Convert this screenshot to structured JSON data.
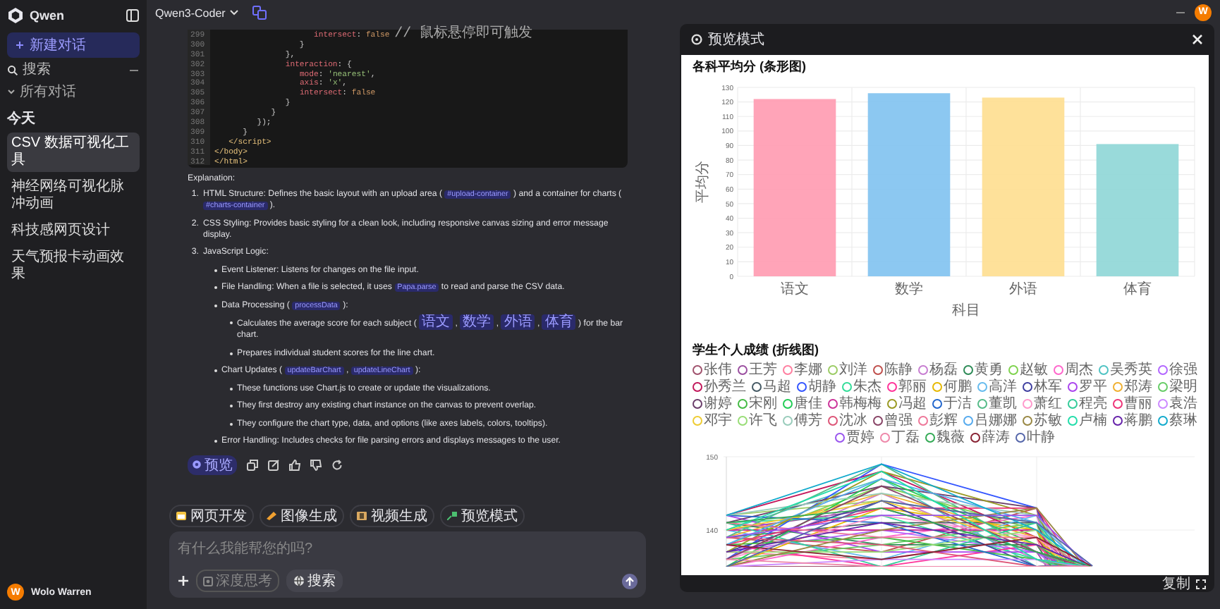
{
  "sidebar": {
    "brand": "Qwen",
    "new_chat": "新建对话",
    "search": {
      "placeholder": "搜索"
    },
    "section": {
      "label": "所有对话",
      "expanded": true
    },
    "group": "今天",
    "items": [
      {
        "label": "CSV 数据可视化工具",
        "selected": true
      },
      {
        "label": "神经网络可视化脉冲动画",
        "selected": false
      },
      {
        "label": "科技感网页设计",
        "selected": false
      },
      {
        "label": "天气预报卡动画效果",
        "selected": false
      }
    ],
    "user": {
      "initial": "W",
      "name": "Wolo Warren"
    }
  },
  "header": {
    "model": "Qwen3-Coder",
    "avatar": "W"
  },
  "code": {
    "lines": [
      {
        "n": "299",
        "text": "                     intersect: false // 鼠标悬停即可触发"
      },
      {
        "n": "300",
        "text": "                  }"
      },
      {
        "n": "301",
        "text": "               },"
      },
      {
        "n": "302",
        "text": "               interaction: {"
      },
      {
        "n": "303",
        "text": "                  mode: 'nearest',"
      },
      {
        "n": "304",
        "text": "                  axis: 'x',"
      },
      {
        "n": "305",
        "text": "                  intersect: false"
      },
      {
        "n": "306",
        "text": "               }"
      },
      {
        "n": "307",
        "text": "            }"
      },
      {
        "n": "308",
        "text": "         });"
      },
      {
        "n": "309",
        "text": "      }"
      },
      {
        "n": "310",
        "text": "   </script>"
      },
      {
        "n": "311",
        "text": "</body>"
      },
      {
        "n": "312",
        "text": "</html>"
      }
    ]
  },
  "explanation": {
    "heading": "Explanation:",
    "items": [
      {
        "marker": "1.",
        "parts": [
          {
            "text": "HTML Structure: Defines the basic layout with an upload area ( "
          },
          {
            "code": "#upload-container"
          },
          {
            "text": " ) and a container for charts ( "
          },
          {
            "code": "#charts-container"
          },
          {
            "text": " )."
          }
        ]
      },
      {
        "marker": "2.",
        "parts": [
          {
            "text": "CSS Styling: Provides basic styling for a clean look, including responsive canvas sizing and error message display."
          }
        ]
      },
      {
        "marker": "3.",
        "parts": [
          {
            "text": "JavaScript Logic:"
          }
        ],
        "children": [
          {
            "parts": [
              {
                "text": "Event Listener: Listens for changes on the file input."
              }
            ]
          },
          {
            "parts": [
              {
                "text": "File Handling: When a file is selected, it uses "
              },
              {
                "code": "Papa.parse"
              },
              {
                "text": " to read and parse the CSV data."
              }
            ]
          },
          {
            "parts": [
              {
                "text": "Data Processing ( "
              },
              {
                "code": "processData"
              },
              {
                "text": " ):"
              }
            ],
            "children": [
              {
                "parts": [
                  {
                    "text": "Calculates the average score for each subject ( "
                  },
                  {
                    "code": "语文"
                  },
                  {
                    "text": " , "
                  },
                  {
                    "code": "数学"
                  },
                  {
                    "text": " , "
                  },
                  {
                    "code": "外语"
                  },
                  {
                    "text": " , "
                  },
                  {
                    "code": "体育"
                  },
                  {
                    "text": " ) for the bar chart."
                  }
                ]
              },
              {
                "parts": [
                  {
                    "text": "Prepares individual student scores for the line chart."
                  }
                ]
              }
            ]
          },
          {
            "parts": [
              {
                "text": "Chart Updates ( "
              },
              {
                "code": "updateBarChart"
              },
              {
                "text": " , "
              },
              {
                "code": "updateLineChart"
              },
              {
                "text": " ):"
              }
            ],
            "children": [
              {
                "parts": [
                  {
                    "text": "These functions use Chart.js to create or update the visualizations."
                  }
                ]
              },
              {
                "parts": [
                  {
                    "text": "They first destroy any existing chart instance on the canvas to prevent overlap."
                  }
                ]
              },
              {
                "parts": [
                  {
                    "text": "They configure the chart type, data, and options (like axes labels, colors, tooltips)."
                  }
                ]
              }
            ]
          },
          {
            "parts": [
              {
                "text": "Error Handling: Includes checks for file parsing errors and displays messages to the user."
              }
            ]
          }
        ]
      }
    ]
  },
  "actions": {
    "preview": "预览"
  },
  "chips": [
    {
      "label": "网页开发",
      "kind": "web"
    },
    {
      "label": "图像生成",
      "kind": "image"
    },
    {
      "label": "视频生成",
      "kind": "video"
    },
    {
      "label": "预览模式",
      "kind": "preview"
    }
  ],
  "composer": {
    "placeholder": "有什么我能帮您的吗?",
    "deep_think": {
      "label": "深度思考",
      "on": false
    },
    "search": "搜索"
  },
  "preview": {
    "title": "预览模式",
    "copy": "复制",
    "bar_chart": {
      "title": "各科平均分 (条形图)",
      "chart_data": {
        "type": "bar",
        "xlabel": "科目",
        "ylabel": "平均分",
        "categories": [
          "语文",
          "数学",
          "外语",
          "体育"
        ],
        "values": [
          122,
          126,
          123,
          91
        ],
        "colors": [
          "#ff9fb4",
          "#86c5f0",
          "#fedf95",
          "#93d8d8"
        ],
        "grid": true,
        "ylim": [
          0,
          130
        ],
        "yticks": [
          0,
          10,
          20,
          30,
          40,
          50,
          60,
          70,
          80,
          90,
          100,
          110,
          120,
          130
        ]
      }
    },
    "line_chart": {
      "title": "学生个人成绩 (折线图)",
      "yticks": [
        "150",
        "140"
      ],
      "legend": [
        {
          "name": "张伟",
          "color": "#a0526d"
        },
        {
          "name": "王芳",
          "color": "#9b4fa0"
        },
        {
          "name": "李娜",
          "color": "#ff7fa0"
        },
        {
          "name": "刘洋",
          "color": "#9ccc65"
        },
        {
          "name": "陈静",
          "color": "#c0504d"
        },
        {
          "name": "杨磊",
          "color": "#c77dd1"
        },
        {
          "name": "黄勇",
          "color": "#2e8b57"
        },
        {
          "name": "赵敏",
          "color": "#7fd34e"
        },
        {
          "name": "周杰",
          "color": "#ff66cc"
        },
        {
          "name": "吴秀英",
          "color": "#4fc3c3"
        },
        {
          "name": "徐强",
          "color": "#b266ff"
        },
        {
          "name": "孙秀兰",
          "color": "#c2185b"
        },
        {
          "name": "马超",
          "color": "#455a64"
        },
        {
          "name": "胡静",
          "color": "#3355ff"
        },
        {
          "name": "朱杰",
          "color": "#33dd99"
        },
        {
          "name": "郭丽",
          "color": "#ff3399"
        },
        {
          "name": "何鹏",
          "color": "#e6b800"
        },
        {
          "name": "高洋",
          "color": "#66bbee"
        },
        {
          "name": "林军",
          "color": "#3f3fa0"
        },
        {
          "name": "罗平",
          "color": "#aa44ee"
        },
        {
          "name": "郑涛",
          "color": "#f0b030"
        },
        {
          "name": "梁明",
          "color": "#66cc66"
        },
        {
          "name": "谢婷",
          "color": "#6a3d6a"
        },
        {
          "name": "宋刚",
          "color": "#44bb44"
        },
        {
          "name": "唐佳",
          "color": "#22cc55"
        },
        {
          "name": "韩梅梅",
          "color": "#cc3399"
        },
        {
          "name": "冯超",
          "color": "#999922"
        },
        {
          "name": "于洁",
          "color": "#2266cc"
        },
        {
          "name": "董凯",
          "color": "#55bb88"
        },
        {
          "name": "萧红",
          "color": "#ff99cc"
        },
        {
          "name": "程亮",
          "color": "#33cc99"
        },
        {
          "name": "曹丽",
          "color": "#ee3377"
        },
        {
          "name": "袁浩",
          "color": "#cc88ff"
        },
        {
          "name": "邓宇",
          "color": "#eecc33"
        },
        {
          "name": "许飞",
          "color": "#99dd77"
        },
        {
          "name": "傅芳",
          "color": "#99ccbb"
        },
        {
          "name": "沈冰",
          "color": "#dd5577"
        },
        {
          "name": "曾强",
          "color": "#884466"
        },
        {
          "name": "彭辉",
          "color": "#ee7799"
        },
        {
          "name": "吕娜娜",
          "color": "#55aaee"
        },
        {
          "name": "苏敏",
          "color": "#998844"
        },
        {
          "name": "卢楠",
          "color": "#22ddaa"
        },
        {
          "name": "蒋鹏",
          "color": "#6622aa"
        },
        {
          "name": "蔡琳",
          "color": "#11aacc"
        },
        {
          "name": "贾婷",
          "color": "#9955ee"
        },
        {
          "name": "丁磊",
          "color": "#ee88aa"
        },
        {
          "name": "魏薇",
          "color": "#33aa55"
        },
        {
          "name": "薛涛",
          "color": "#882233"
        },
        {
          "name": "叶静",
          "color": "#5566aa"
        }
      ]
    }
  }
}
